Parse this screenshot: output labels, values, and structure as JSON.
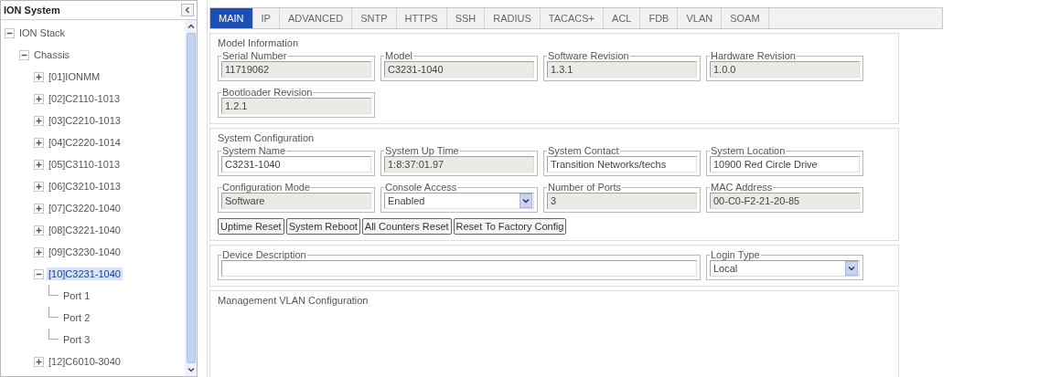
{
  "sidebar": {
    "title": "ION System",
    "tree": [
      {
        "label": "ION Stack",
        "expanded": true,
        "selected": false,
        "children": [
          {
            "label": "Chassis",
            "expanded": true,
            "selected": false,
            "children": [
              {
                "label": "[01]IONMM",
                "expanded": false,
                "selected": false
              },
              {
                "label": "[02]C2110-1013",
                "expanded": false,
                "selected": false
              },
              {
                "label": "[03]C2210-1013",
                "expanded": false,
                "selected": false
              },
              {
                "label": "[04]C2220-1014",
                "expanded": false,
                "selected": false
              },
              {
                "label": "[05]C3110-1013",
                "expanded": false,
                "selected": false
              },
              {
                "label": "[06]C3210-1013",
                "expanded": false,
                "selected": false
              },
              {
                "label": "[07]C3220-1040",
                "expanded": false,
                "selected": false
              },
              {
                "label": "[08]C3221-1040",
                "expanded": false,
                "selected": false
              },
              {
                "label": "[09]C3230-1040",
                "expanded": false,
                "selected": false
              },
              {
                "label": "[10]C3231-1040",
                "expanded": true,
                "selected": true,
                "children": [
                  {
                    "label": "Port 1",
                    "selected": false
                  },
                  {
                    "label": "Port 2",
                    "selected": false
                  },
                  {
                    "label": "Port 3",
                    "selected": false
                  }
                ]
              },
              {
                "label": "[12]C6010-3040",
                "expanded": false,
                "selected": false
              }
            ]
          }
        ]
      }
    ]
  },
  "tabs": [
    {
      "label": "MAIN",
      "selected": true
    },
    {
      "label": "IP",
      "selected": false
    },
    {
      "label": "ADVANCED",
      "selected": false
    },
    {
      "label": "SNTP",
      "selected": false
    },
    {
      "label": "HTTPS",
      "selected": false
    },
    {
      "label": "SSH",
      "selected": false
    },
    {
      "label": "RADIUS",
      "selected": false
    },
    {
      "label": "TACACS+",
      "selected": false
    },
    {
      "label": "ACL",
      "selected": false
    },
    {
      "label": "FDB",
      "selected": false
    },
    {
      "label": "VLAN",
      "selected": false
    },
    {
      "label": "SOAM",
      "selected": false
    }
  ],
  "model_information": {
    "title": "Model Information",
    "fields": [
      {
        "label": "Serial Number",
        "value": "11719062",
        "kind": "text",
        "readonly": true
      },
      {
        "label": "Model",
        "value": "C3231-1040",
        "kind": "text",
        "readonly": true
      },
      {
        "label": "Software Revision",
        "value": "1.3.1",
        "kind": "text",
        "readonly": true
      },
      {
        "label": "Hardware Revision",
        "value": "1.0.0",
        "kind": "text",
        "readonly": true
      },
      {
        "label": "Bootloader Revision",
        "value": "1.2.1",
        "kind": "text",
        "readonly": true
      }
    ]
  },
  "system_configuration": {
    "title": "System Configuration",
    "fields": [
      {
        "label": "System Name",
        "value": "C3231-1040",
        "kind": "text",
        "readonly": false
      },
      {
        "label": "System Up Time",
        "value": "1:8:37:01.97",
        "kind": "text",
        "readonly": true
      },
      {
        "label": "System Contact",
        "value": "Transition Networks/techs",
        "kind": "text",
        "readonly": false
      },
      {
        "label": "System Location",
        "value": "10900 Red Circle Drive",
        "kind": "text",
        "readonly": false
      },
      {
        "label": "Configuration Mode",
        "value": "Software",
        "kind": "text",
        "readonly": true
      },
      {
        "label": "Console Access",
        "value": "Enabled",
        "kind": "select",
        "readonly": false
      },
      {
        "label": "Number of Ports",
        "value": "3",
        "kind": "text",
        "readonly": true
      },
      {
        "label": "MAC Address",
        "value": "00-C0-F2-21-20-85",
        "kind": "text",
        "readonly": true
      }
    ],
    "buttons": [
      "Uptime Reset",
      "System Reboot",
      "All Counters Reset",
      "Reset To Factory Config"
    ]
  },
  "device": {
    "description_field": {
      "label": "Device Description",
      "kind": "text",
      "readonly": false
    },
    "login_type_field": {
      "label": "Login Type",
      "value": "Local",
      "kind": "select",
      "readonly": false
    }
  },
  "management_vlan": {
    "title": "Management VLAN Configuration"
  }
}
